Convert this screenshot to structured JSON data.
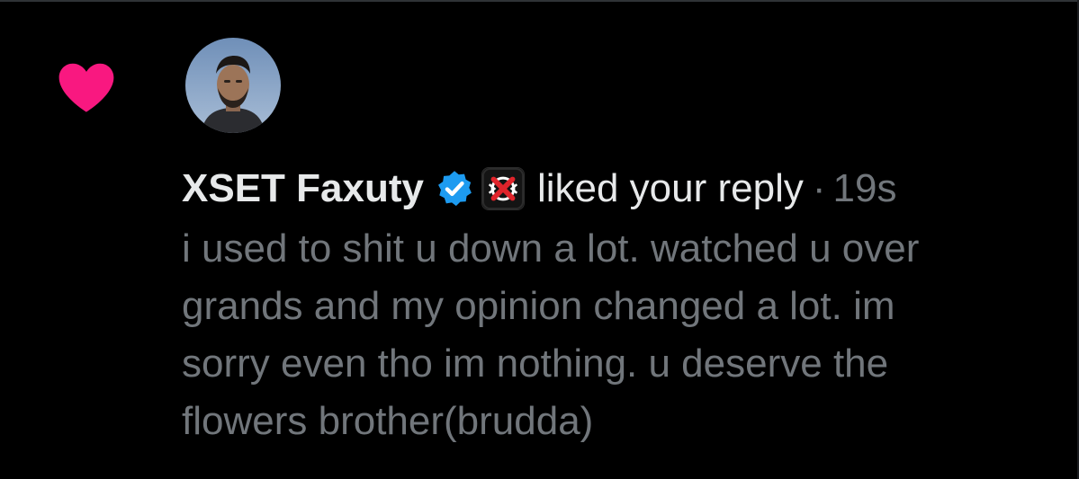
{
  "colors": {
    "background": "#000000",
    "heart": "#f91880",
    "verified": "#1d9bf0",
    "primary_text": "#e7e9ea",
    "secondary_text": "#71767b",
    "affiliate_accent": "#e0242b"
  },
  "icons": {
    "notification_type": "heart-icon",
    "verified": "verified-badge-icon",
    "affiliate": "xset-logo-icon"
  },
  "notification": {
    "author_name": "XSET Faxuty",
    "action": "liked your reply",
    "separator": "·",
    "timestamp": "19s",
    "reply_lines": [
      "i used to shit u down a lot. watched u over",
      "grands and my opinion changed a lot. im",
      "sorry even tho im nothing. u deserve the",
      "flowers brother(brudda)"
    ]
  }
}
